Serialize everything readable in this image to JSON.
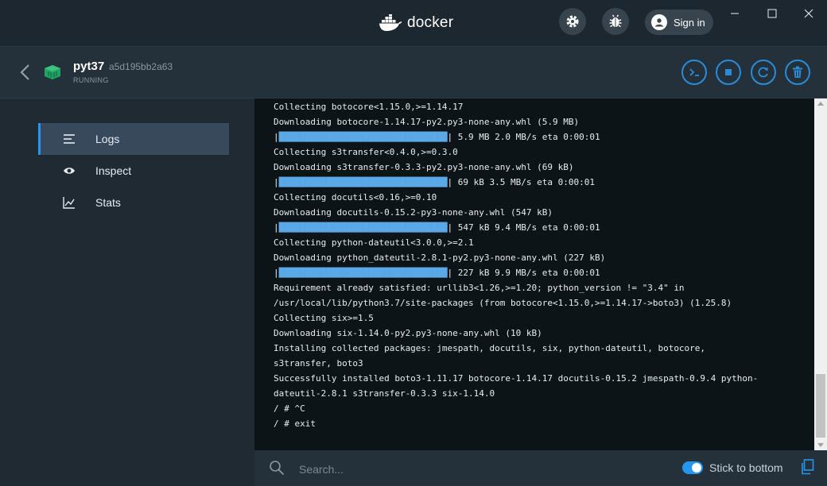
{
  "titlebar": {
    "brand": "docker",
    "signin_label": "Sign in",
    "icons": [
      "settings-icon",
      "bug-icon",
      "user-icon",
      "minimize-icon",
      "maximize-icon",
      "close-icon"
    ]
  },
  "container": {
    "name": "pyt37",
    "id": "a5d195bb2a63",
    "status": "RUNNING",
    "actions": [
      "cli-icon",
      "stop-icon",
      "restart-icon",
      "delete-icon"
    ]
  },
  "sidebar": {
    "items": [
      {
        "label": "Logs",
        "icon": "logs-icon",
        "active": true
      },
      {
        "label": "Inspect",
        "icon": "eye-icon",
        "active": false
      },
      {
        "label": "Stats",
        "icon": "chart-icon",
        "active": false
      }
    ]
  },
  "logs": {
    "lines": [
      "Collecting botocore<1.15.0,>=1.14.17",
      "Downloading botocore-1.14.17-py2.py3-none-any.whl (5.9 MB)",
      "|████████████████████████████████| 5.9 MB 2.0 MB/s eta 0:00:01",
      "Collecting s3transfer<0.4.0,>=0.3.0",
      "Downloading s3transfer-0.3.3-py2.py3-none-any.whl (69 kB)",
      "|████████████████████████████████| 69 kB 3.5 MB/s eta 0:00:01",
      "Collecting docutils<0.16,>=0.10",
      "Downloading docutils-0.15.2-py3-none-any.whl (547 kB)",
      "|████████████████████████████████| 547 kB 9.4 MB/s eta 0:00:01",
      "Collecting python-dateutil<3.0.0,>=2.1",
      "Downloading python_dateutil-2.8.1-py2.py3-none-any.whl (227 kB)",
      "|████████████████████████████████| 227 kB 9.9 MB/s eta 0:00:01",
      "Requirement already satisfied: urllib3<1.26,>=1.20; python_version != \"3.4\" in",
      "/usr/local/lib/python3.7/site-packages (from botocore<1.15.0,>=1.14.17->boto3) (1.25.8)",
      "Collecting six>=1.5",
      "Downloading six-1.14.0-py2.py3-none-any.whl (10 kB)",
      "Installing collected packages: jmespath, docutils, six, python-dateutil, botocore,",
      "s3transfer, boto3",
      "Successfully installed boto3-1.11.17 botocore-1.14.17 docutils-0.15.2 jmespath-0.9.4 python-",
      "dateutil-2.8.1 s3transfer-0.3.3 six-1.14.0",
      "/ # ^C",
      "/ # exit"
    ]
  },
  "search": {
    "placeholder": "Search..."
  },
  "stick_to_bottom": {
    "label": "Stick to bottom",
    "enabled": true
  },
  "colors": {
    "accent": "#2496ed",
    "log_background": "#0d1418",
    "progress_bar": "#5aa9e6"
  }
}
